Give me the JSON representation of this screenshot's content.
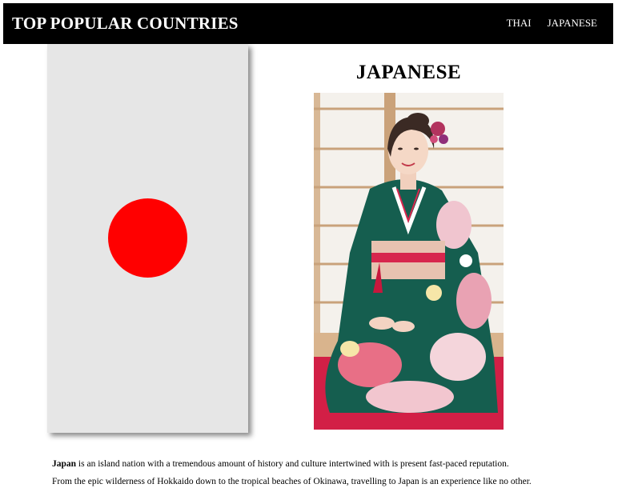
{
  "navbar": {
    "brand": "TOP POPULAR COUNTRIES",
    "links": [
      {
        "label": "THAI"
      },
      {
        "label": "JAPANESE"
      }
    ]
  },
  "flag": {
    "background_color": "#e6e6e6",
    "circle_color": "#ff0000"
  },
  "country": {
    "title": "JAPANESE",
    "photo": "woman in green floral kimono kneeling"
  },
  "description": {
    "paragraph1_bold": "Japan",
    "paragraph1_rest": " is an island nation with a tremendous amount of history and culture intertwined with is present fast-paced reputation.",
    "paragraph2": "From the epic wilderness of Hokkaido down to the tropical beaches of Okinawa, travelling to Japan is an experience like no other."
  }
}
